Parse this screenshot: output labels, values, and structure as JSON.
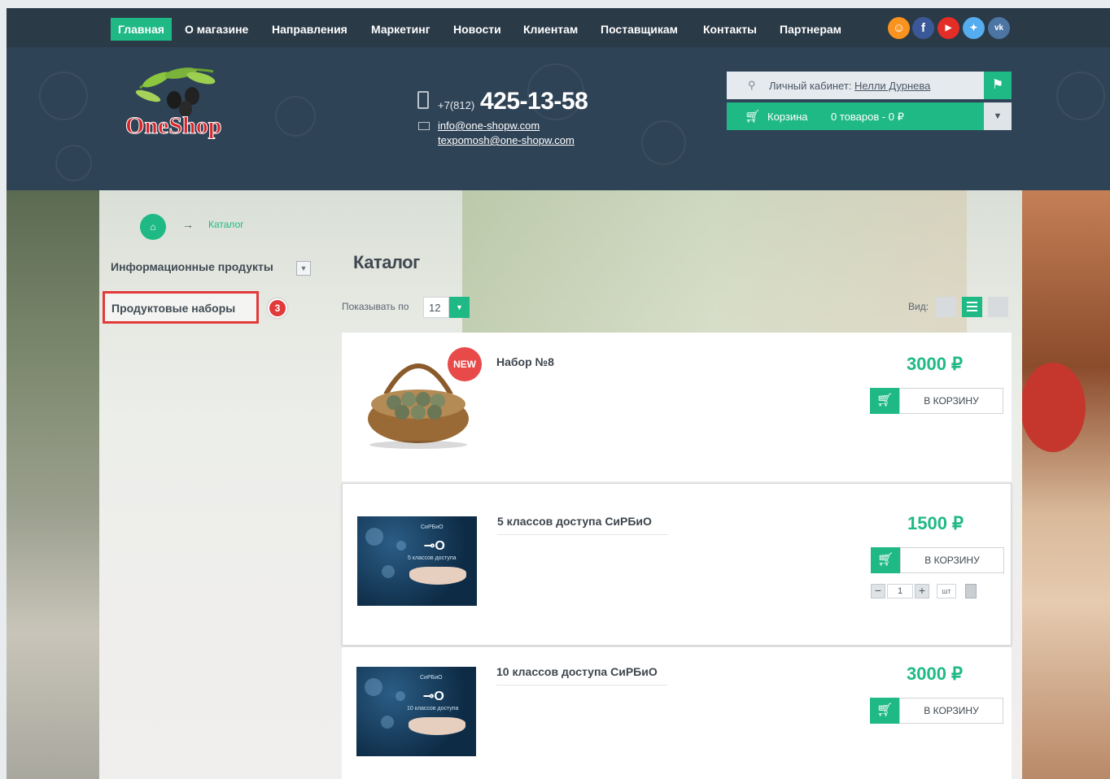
{
  "nav": {
    "items": [
      "Главная",
      "О магазине",
      "Направления",
      "Маркетинг",
      "Новости",
      "Клиентам",
      "Поставщикам",
      "Контакты",
      "Партнерам"
    ],
    "social": [
      "odnoklassniki-icon",
      "facebook-icon",
      "youtube-icon",
      "twitter-icon",
      "vk-icon"
    ]
  },
  "header": {
    "logo_text": "OneShop",
    "phone_prefix": "+7(812)",
    "phone_number": "425-13-58",
    "email1": "info@one-shopw.com",
    "email2": "texpomosh@one-shopw.com",
    "cabinet_label": "Личный кабинет:",
    "cabinet_user": "Нелли Дурнева",
    "cart_label": "Корзина",
    "cart_count": "0 товаров - 0 ₽"
  },
  "breadcrumb": {
    "current": "Каталог"
  },
  "sidebar": {
    "items": [
      {
        "label": "Информационные продукты"
      },
      {
        "label": "Продуктовые наборы"
      }
    ],
    "marker": "3"
  },
  "catalog": {
    "title": "Каталог",
    "show_label": "Показывать по",
    "per_page": "12",
    "view_label": "Вид:",
    "add_to_cart_label": "В КОРЗИНУ",
    "new_badge": "NEW",
    "qty_value": "1",
    "qty_unit": "шт",
    "products": [
      {
        "name": "Набор №8",
        "price": "3000 ₽"
      },
      {
        "name": "5 классов доступа СиРБиО",
        "price": "1500 ₽",
        "image_title": "СиРБиО",
        "image_sub": "5 классов доступа"
      },
      {
        "name": "10 классов доступа СиРБиО",
        "price": "3000 ₽",
        "image_title": "СиРБиО",
        "image_sub": "10 классов доступа"
      }
    ]
  },
  "colors": {
    "accent": "#1fb985",
    "nav_bg": "#2b3a47",
    "header_bg": "#2f4356",
    "highlight": "#e23a3a"
  }
}
